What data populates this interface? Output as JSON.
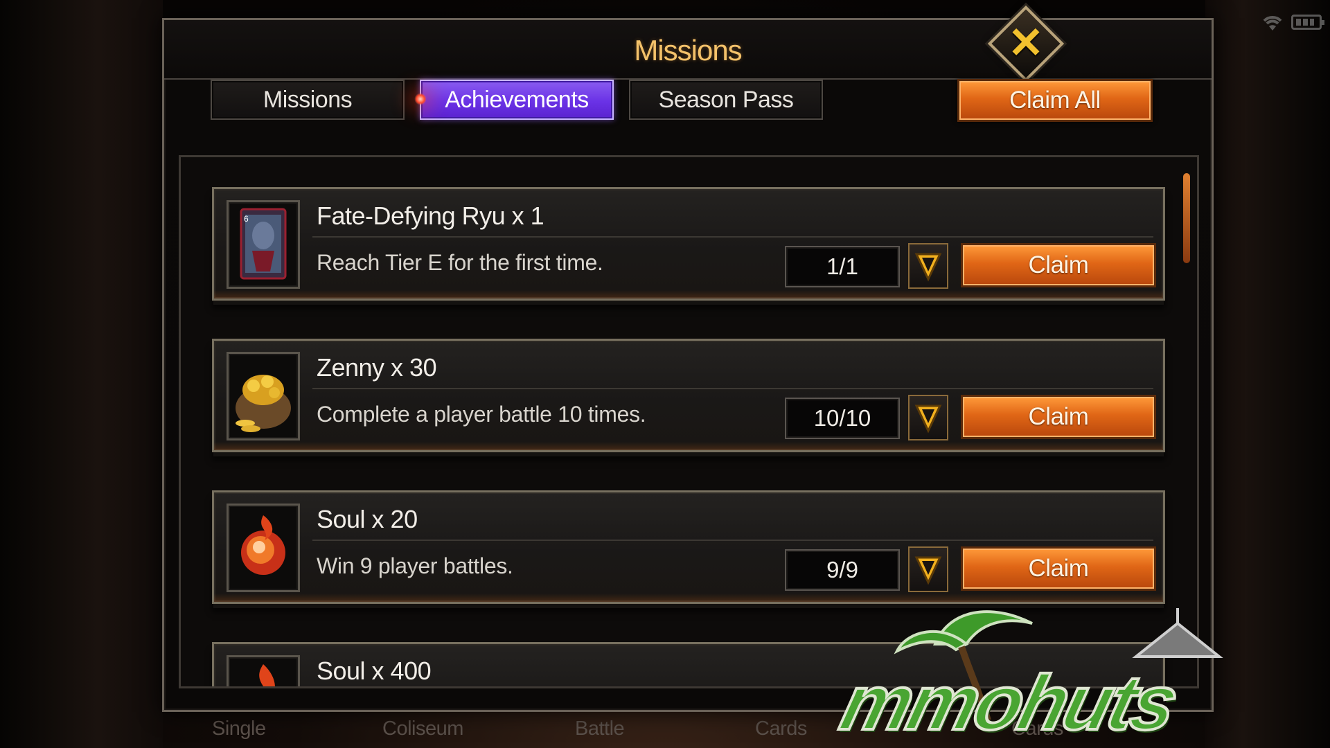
{
  "window": {
    "title": "Missions"
  },
  "tabs": [
    {
      "label": "Missions",
      "active": false
    },
    {
      "label": "Achievements",
      "active": true
    },
    {
      "label": "Season Pass",
      "active": false
    }
  ],
  "claim_all_label": "Claim All",
  "missions": [
    {
      "icon": "ryu-card-icon",
      "reward": "Fate-Defying Ryu x 1",
      "description": "Reach Tier E for the first time.",
      "progress": "1/1",
      "claim_label": "Claim"
    },
    {
      "icon": "gold-coin-bag-icon",
      "reward": "Zenny x 30",
      "description": "Complete a player battle 10 times.",
      "progress": "10/10",
      "claim_label": "Claim"
    },
    {
      "icon": "fire-soul-orb-icon",
      "reward": "Soul x 20",
      "description": "Win 9 player battles.",
      "progress": "9/9",
      "claim_label": "Claim"
    },
    {
      "icon": "fire-soul-icon",
      "reward": "Soul x 400"
    }
  ],
  "bottom_nav": [
    "Single",
    "Coliseum",
    "Battle",
    "Cards",
    "Cards"
  ],
  "watermark": "mmohuts",
  "colors": {
    "accent_orange": "#e06616",
    "active_tab_purple": "#6a32e6",
    "title_gold": "#f4c26a"
  }
}
